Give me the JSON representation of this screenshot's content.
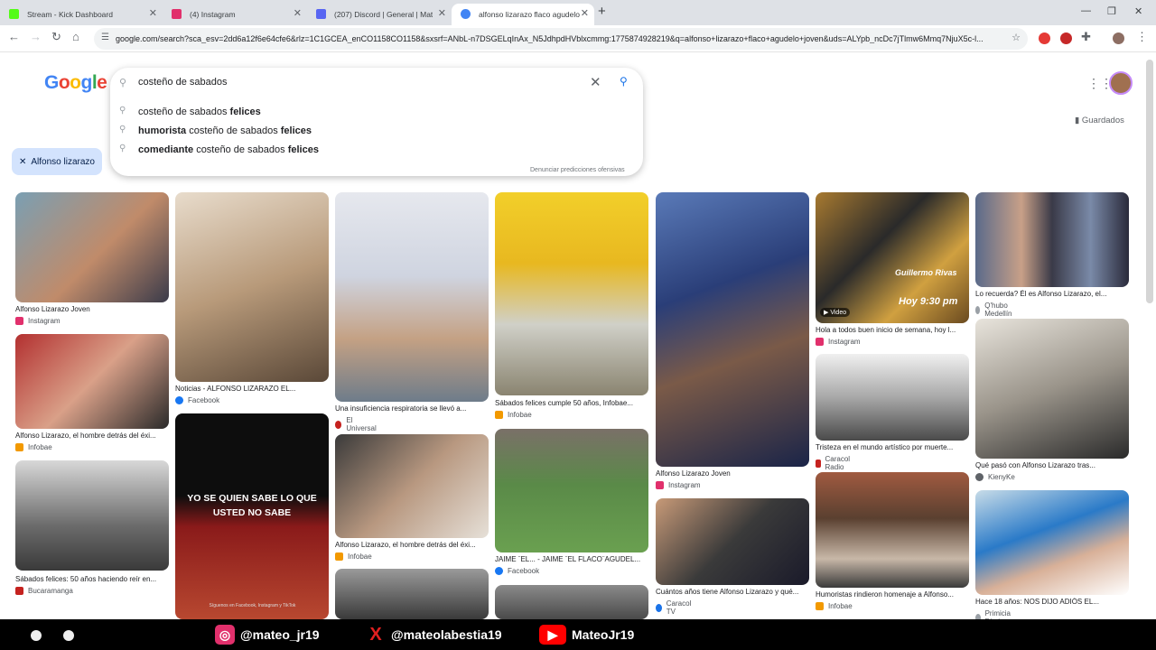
{
  "tabs": [
    {
      "title": "Stream - Kick Dashboard",
      "color": "#53fc18"
    },
    {
      "title": "(4) Instagram",
      "color": "#e1306c"
    },
    {
      "title": "(207) Discord | General | Mat",
      "color": "#5865f2"
    },
    {
      "title": "alfonso lizarazo flaco agudelo",
      "color": "#4285f4"
    }
  ],
  "window": {
    "minimize": "—",
    "restore": "❐",
    "close": "✕",
    "new_tab": "+"
  },
  "toolbar": {
    "url": "google.com/search?sca_esv=2dd6a12f6e64cfe6&rlz=1C1GCEA_enCO1158CO1158&sxsrf=ANbL-n7DSGELqInAx_N5JdhpdHVblxcmmg:1775874928219&q=alfonso+lizarazo+flaco+agudelo+joven&uds=ALYpb_ncDc7jTlmw6Mmq7NjuX5c-l..."
  },
  "logo": "Google",
  "search": {
    "query": "costeño de sabados",
    "report": "Denunciar predicciones ofensivas"
  },
  "suggestions": [
    {
      "pre": "",
      "base": "costeño de sabados ",
      "bold": "felices"
    },
    {
      "pre": "humorista ",
      "base": "costeño de sabados ",
      "bold": "felices"
    },
    {
      "pre": "comediante ",
      "base": "costeño de sabados ",
      "bold": "felices"
    }
  ],
  "saved": "Guardados",
  "chip": "Alfonso lizarazo",
  "results": [
    {
      "caption": "Alfonso Lizarazo Joven",
      "source": "Instagram",
      "color": "#e1306c"
    },
    {
      "caption": "Alfonso Lizarazo, el hombre detrás del éxi...",
      "source": "Infobae",
      "color": "#f29900"
    },
    {
      "caption": "Sábados felices: 50 años haciendo reír en...",
      "source": "Bucaramanga",
      "color": "#c5221f"
    },
    {
      "caption": "Noticias - ALFONSO LIZARAZO EL...",
      "source": "Facebook",
      "color": "#1877f2"
    },
    {
      "caption": "",
      "source": "",
      "color": "#000000"
    },
    {
      "caption": "Una insuficiencia respiratoria se llevó a...",
      "source": "El Universal",
      "color": "#c5221f"
    },
    {
      "caption": "Alfonso Lizarazo, el hombre detrás del éxi...",
      "source": "Infobae",
      "color": "#f29900"
    },
    {
      "caption": "Sábados felices cumple 50 años, Infobae...",
      "source": "Infobae",
      "color": "#f29900"
    },
    {
      "caption": "JAIME ¨EL... - JAIME ¨EL FLACO¨AGUDEL...",
      "source": "Facebook",
      "color": "#1877f2"
    },
    {
      "caption": "Alfonso Lizarazo Joven",
      "source": "Instagram",
      "color": "#e1306c"
    },
    {
      "caption": "Cuántos años tiene Alfonso Lizarazo y qué...",
      "source": "Caracol TV",
      "color": "#1a73e8"
    },
    {
      "caption": "Hola a todos buen inicio de semana, hoy l...",
      "source": "Instagram",
      "color": "#e1306c"
    },
    {
      "caption": "Tristeza en el mundo artístico por muerte...",
      "source": "Caracol Radio",
      "color": "#c5221f"
    },
    {
      "caption": "Humoristas rindieron homenaje a Alfonso...",
      "source": "Infobae",
      "color": "#f29900"
    },
    {
      "caption": "Lo recuerda? Él es Alfonso Lizarazo, el...",
      "source": "Q'hubo Medellín",
      "color": "#9aa0a6"
    },
    {
      "caption": "Qué pasó con Alfonso Lizarazo tras...",
      "source": "KienyKe",
      "color": "#5f6368"
    },
    {
      "caption": "Hace 18 años: NOS DIJO ADIÓS EL...",
      "source": "Primicia Diario",
      "color": "#9aa0a6"
    }
  ],
  "video_badge": "▶ Video",
  "overlay_texts": {
    "red_banner": "YO SE QUIEN SABE LO QUE USTED NO SABE",
    "tv_name": "Guillermo Rivas",
    "tv_time": "Hoy 9:30 pm",
    "footer": "Síguenos en Facebook, Instagram y TikTok"
  },
  "socials": [
    {
      "handle": "@mateo_jr19",
      "color": "#e1306c",
      "glyph": "◎"
    },
    {
      "handle": "@mateolabestia19",
      "color": "#e02020",
      "glyph": "X"
    },
    {
      "handle": "MateoJr19",
      "color": "#ff0000",
      "glyph": "▶"
    }
  ]
}
